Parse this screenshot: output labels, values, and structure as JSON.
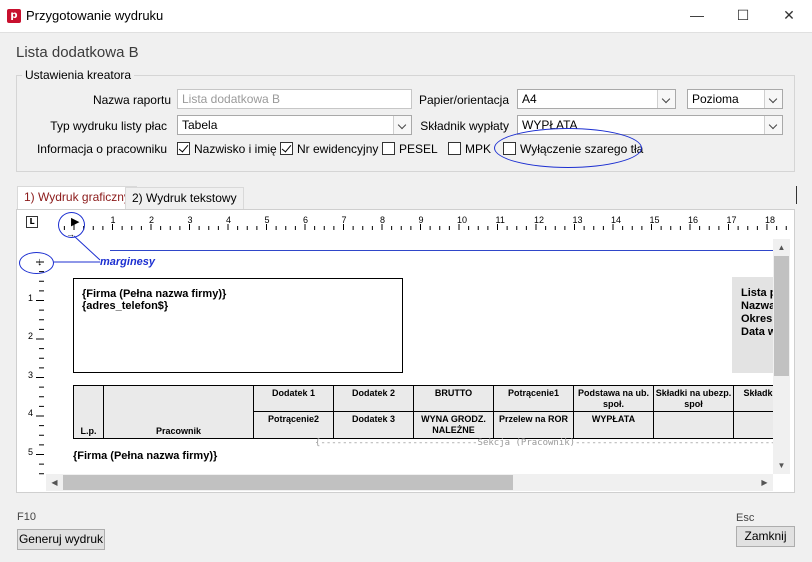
{
  "window": {
    "title": "Przygotowanie wydruku",
    "app_icon": "p"
  },
  "heading": "Lista dodatkowa B",
  "settings": {
    "group_title": "Ustawienia kreatora",
    "report_name_label": "Nazwa raportu",
    "report_name_value": "Lista dodatkowa B",
    "paper_label": "Papier/orientacja",
    "paper_value": "A4",
    "orientation_value": "Pozioma",
    "print_type_label": "Typ wydruku listy płac",
    "print_type_value": "Tabela",
    "payout_label": "Składnik wypłaty",
    "payout_value": "WYPŁATA",
    "employee_info_label": "Informacja o pracowniku",
    "checkboxes": [
      {
        "label": "Nazwisko i imię",
        "checked": true
      },
      {
        "label": "Nr ewidencyjny",
        "checked": true
      },
      {
        "label": "PESEL",
        "checked": false
      },
      {
        "label": "MPK",
        "checked": false
      },
      {
        "label": "Wyłączenie szarego tła",
        "checked": false
      }
    ]
  },
  "tabs": [
    {
      "label": "1) Wydruk graficzny",
      "active": true
    },
    {
      "label": "2) Wydruk tekstowy",
      "active": false
    }
  ],
  "preview": {
    "corner_button": "L",
    "ruler_numbers": [
      "1",
      "2",
      "3",
      "4",
      "5",
      "6",
      "7",
      "8",
      "9",
      "10",
      "11",
      "12",
      "13",
      "14",
      "15",
      "16",
      "17",
      "18"
    ],
    "vruler_numbers": [
      "1",
      "2",
      "3",
      "4",
      "5"
    ],
    "annotation": "marginesy",
    "company_line1": "{Firma (Pełna nazwa firmy)}",
    "company_line2": "{adres_telefon$}",
    "right_box_lines": [
      "Lista p",
      "Nazwa",
      "Okres",
      "Data w"
    ],
    "table": {
      "lp": "L.p.",
      "employee": "Pracownik",
      "row1": [
        "Dodatek  1",
        "Dodatek  2",
        "BRUTTO",
        "Potrącenie1",
        "Podstawa na ub. społ.",
        "Składki na ubezp. społ",
        "Składki zdrow"
      ],
      "row2": [
        "Potrącenie2",
        "Dodatek  3",
        "WYNA GRODZ. NALEŻNE",
        "Przelew na ROR",
        "WYPŁATA",
        "",
        ""
      ]
    },
    "section_text": "{-----------------------------Sekcja (Pracownik)----------------------------------------------",
    "footer_company": "{Firma (Pełna nazwa firmy)}"
  },
  "footer": {
    "f10_label": "F10",
    "generate_button": "Generuj wydruk",
    "esc_label": "Esc",
    "close_button": "Zamknij"
  },
  "colors": {
    "annotation_blue": "#1c2fd1",
    "active_tab_text": "#8b1a1a",
    "header_gray": "#eaeaea"
  }
}
